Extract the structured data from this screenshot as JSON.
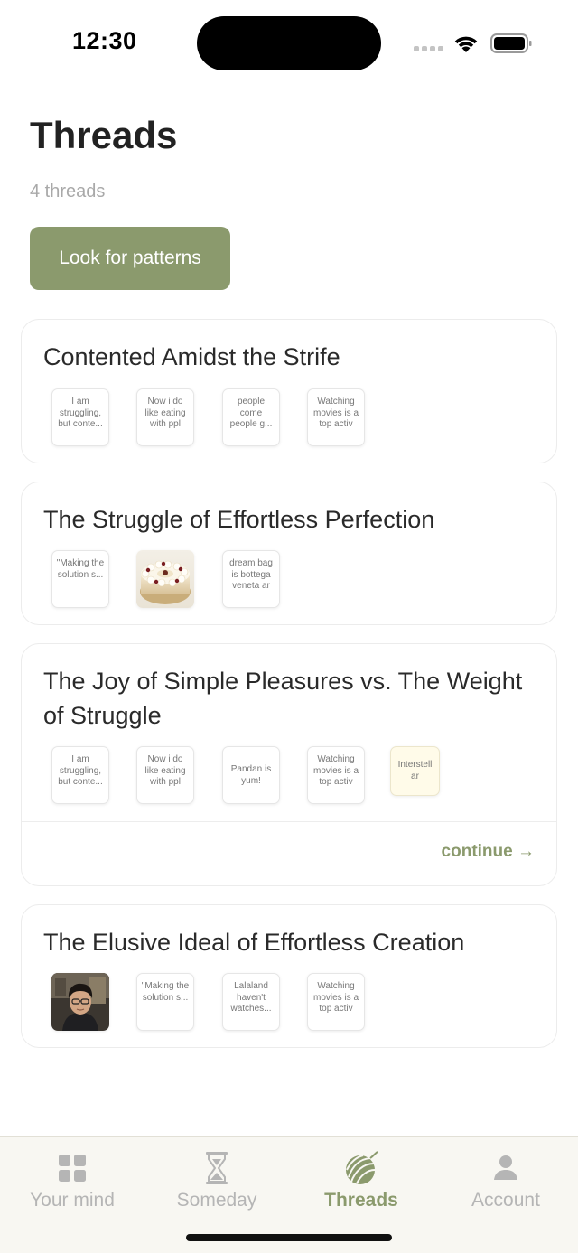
{
  "status_bar": {
    "time": "12:30"
  },
  "header": {
    "title": "Threads",
    "count_label": "4 threads",
    "patterns_button": "Look for patterns"
  },
  "threads": [
    {
      "title": "Contented Amidst the Strife",
      "items": [
        {
          "type": "note",
          "text": "I am struggling, but conte..."
        },
        {
          "type": "note",
          "text": "Now i do like eating with ppl"
        },
        {
          "type": "note",
          "text": "people come people g..."
        },
        {
          "type": "note",
          "text": "Watching movies is a top activ"
        }
      ]
    },
    {
      "title": "The Struggle of Effortless Perfection",
      "items": [
        {
          "type": "note",
          "text": "\"Making the solution s..."
        },
        {
          "type": "image",
          "icon": "cake-photo"
        },
        {
          "type": "note",
          "text": "dream bag is bottega veneta ar"
        }
      ]
    },
    {
      "title": "The Joy of Simple Pleasures vs. The Weight of Struggle",
      "items": [
        {
          "type": "note",
          "text": "I am struggling, but conte..."
        },
        {
          "type": "note",
          "text": "Now i do like eating with ppl"
        },
        {
          "type": "note",
          "text": "Pandan is yum!"
        },
        {
          "type": "note",
          "text": "Watching movies is a top activ"
        },
        {
          "type": "note-yellow",
          "text": "Interstell ar"
        }
      ],
      "continue_label": "continue →"
    },
    {
      "title": "The Elusive Ideal of Effortless Creation",
      "items": [
        {
          "type": "image",
          "icon": "portrait-photo"
        },
        {
          "type": "note",
          "text": "\"Making the solution s..."
        },
        {
          "type": "note",
          "text": "Lalaland haven't watches..."
        },
        {
          "type": "note",
          "text": "Watching movies is a top activ"
        }
      ]
    }
  ],
  "tab_bar": {
    "tabs": [
      {
        "label": "Your mind",
        "icon": "grid-icon"
      },
      {
        "label": "Someday",
        "icon": "hourglass-icon"
      },
      {
        "label": "Threads",
        "icon": "yarn-ball-icon",
        "active": true
      },
      {
        "label": "Account",
        "icon": "person-icon"
      }
    ]
  },
  "colors": {
    "accent": "#8b9a6d",
    "muted": "#b5b5b5",
    "tab_bg": "#f8f7f2"
  }
}
